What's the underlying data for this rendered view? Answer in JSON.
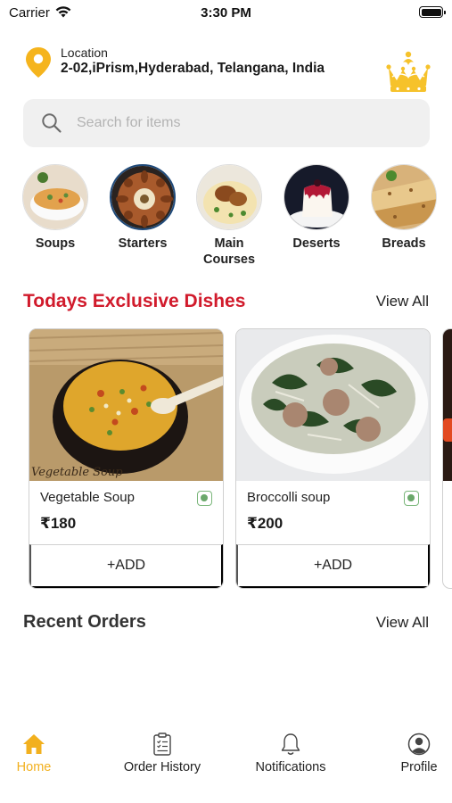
{
  "status_bar": {
    "carrier": "Carrier",
    "time": "3:30 PM"
  },
  "location": {
    "label": "Location",
    "address": "2-02,iPrism,Hyderabad, Telangana, India"
  },
  "search": {
    "placeholder": "Search for items",
    "value": ""
  },
  "categories": [
    {
      "label": "Soups"
    },
    {
      "label": "Starters"
    },
    {
      "label": "Main\nCourses"
    },
    {
      "label": "Deserts"
    },
    {
      "label": "Breads"
    }
  ],
  "exclusive": {
    "title": "Todays Exclusive Dishes",
    "view_all": "View All",
    "dishes": [
      {
        "name": "Vegetable Soup",
        "price": "₹180",
        "add_label": "+ADD",
        "image_caption": "Vegetable Soup"
      },
      {
        "name": "Broccolli soup",
        "price": "₹200",
        "add_label": "+ADD"
      }
    ]
  },
  "recent_orders": {
    "title": "Recent Orders",
    "view_all": "View All"
  },
  "bottom_nav": {
    "items": [
      {
        "label": "Home",
        "icon": "home-icon",
        "active": true
      },
      {
        "label": "Order History",
        "icon": "clipboard-icon",
        "active": false
      },
      {
        "label": "Notifications",
        "icon": "bell-icon",
        "active": false
      },
      {
        "label": "Profile",
        "icon": "profile-icon",
        "active": false
      }
    ]
  },
  "colors": {
    "accent_red": "#d11b2c",
    "accent_yellow": "#f2b01e",
    "veg_green": "#6aa86a"
  }
}
